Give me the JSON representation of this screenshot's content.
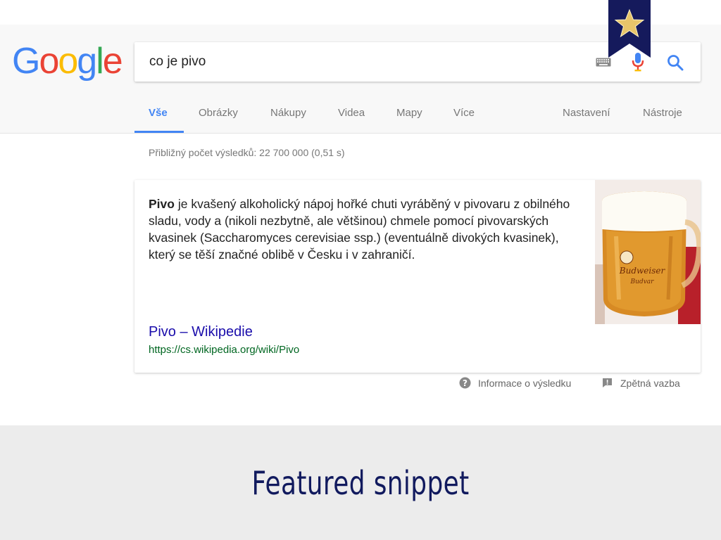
{
  "search": {
    "query": "co je pivo",
    "logo_letters": [
      {
        "ch": "G",
        "color": "#4285f4"
      },
      {
        "ch": "o",
        "color": "#ea4335"
      },
      {
        "ch": "o",
        "color": "#fbbc05"
      },
      {
        "ch": "g",
        "color": "#4285f4"
      },
      {
        "ch": "l",
        "color": "#34a853"
      },
      {
        "ch": "e",
        "color": "#ea4335"
      }
    ]
  },
  "tabs": [
    {
      "label": "Vše",
      "active": true
    },
    {
      "label": "Obrázky",
      "active": false
    },
    {
      "label": "Nákupy",
      "active": false
    },
    {
      "label": "Videa",
      "active": false
    },
    {
      "label": "Mapy",
      "active": false
    },
    {
      "label": "Více",
      "active": false
    },
    {
      "label": "Nastavení",
      "active": false
    },
    {
      "label": "Nástroje",
      "active": false
    }
  ],
  "results": {
    "stats": "Přibližný počet výsledků: 22 700 000 (0,51 s)"
  },
  "snippet": {
    "term": "Pivo",
    "text": " je kvašený alkoholický nápoj hořké chuti vyráběný v pivovaru z obilného sladu, vody a (nikoli nezbytně, ale většinou) chmele pomocí pivovarských kvasinek (Saccharomyces cerevisiae ssp.) (eventuálně divokých kvasinek), který se těší značné oblibě v Česku i v zahraničí.",
    "title": "Pivo – Wikipedie",
    "url": "https://cs.wikipedia.org/wiki/Pivo",
    "image": {
      "mug_label": "Budweiser Budvar",
      "brand_line1": "Budweiser",
      "brand_line2": "Budvar"
    }
  },
  "feedback": {
    "about": "Informace o výsledku",
    "feedback": "Zpětná vazba"
  },
  "caption": "Featured snippet",
  "icons": {
    "keyboard": "keyboard-icon",
    "mic": "microphone-icon",
    "search": "search-icon",
    "help": "help-circle-icon",
    "feedback": "feedback-flag-icon",
    "bookmark": "star-bookmark-icon"
  },
  "colors": {
    "link": "#1a0dab",
    "url": "#006621",
    "accent": "#4285f4",
    "caption": "#111a5e",
    "bookmark": "#151a5c"
  }
}
